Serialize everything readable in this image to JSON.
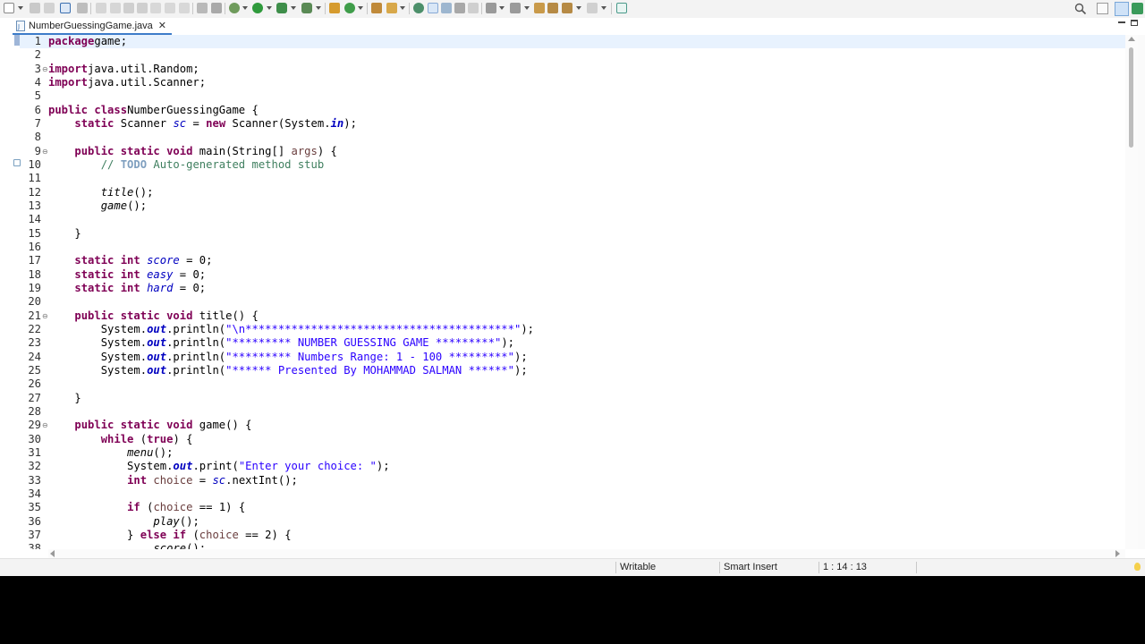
{
  "editor_tab": {
    "label": "NumberGuessingGame.java",
    "close_glyph": "✕"
  },
  "status": {
    "mode": "Writable",
    "insert_mode": "Smart Insert",
    "position": "1 : 14 : 13"
  },
  "code_lines": [
    [
      [
        "kw",
        "package"
      ],
      [
        "",
        "game;"
      ]
    ],
    [],
    [
      [
        "kw",
        "import"
      ],
      [
        "",
        "java.util.Random;"
      ]
    ],
    [
      [
        "kw",
        "import"
      ],
      [
        "",
        "java.util.Scanner;"
      ]
    ],
    [],
    [
      [
        "kw",
        "public class"
      ],
      [
        "",
        "NumberGuessingGame {"
      ]
    ],
    [
      [
        "",
        "    "
      ],
      [
        "kw",
        "static"
      ],
      [
        "",
        " Scanner "
      ],
      [
        "fld",
        "sc"
      ],
      [
        "",
        " = "
      ],
      [
        "kw",
        "new"
      ],
      [
        "",
        " Scanner(System."
      ],
      [
        "sfld",
        "in"
      ],
      [
        "",
        ");"
      ]
    ],
    [],
    [
      [
        "",
        "    "
      ],
      [
        "kw",
        "public static void"
      ],
      [
        "",
        " main(String[] "
      ],
      [
        "var",
        "args"
      ],
      [
        "",
        ") {"
      ]
    ],
    [
      [
        "",
        "        "
      ],
      [
        "cm",
        "// "
      ],
      [
        "todo",
        "TODO"
      ],
      [
        "cm",
        " Auto-generated method stub"
      ]
    ],
    [],
    [
      [
        "",
        "        "
      ],
      [
        "sm",
        "title"
      ],
      [
        "",
        "();"
      ]
    ],
    [
      [
        "",
        "        "
      ],
      [
        "sm",
        "game"
      ],
      [
        "",
        "();"
      ]
    ],
    [],
    [
      [
        "",
        "    }"
      ]
    ],
    [],
    [
      [
        "",
        "    "
      ],
      [
        "kw",
        "static int"
      ],
      [
        "",
        " "
      ],
      [
        "fld",
        "score"
      ],
      [
        "",
        " = 0;"
      ]
    ],
    [
      [
        "",
        "    "
      ],
      [
        "kw",
        "static int"
      ],
      [
        "",
        " "
      ],
      [
        "fld",
        "easy"
      ],
      [
        "",
        " = 0;"
      ]
    ],
    [
      [
        "",
        "    "
      ],
      [
        "kw",
        "static int"
      ],
      [
        "",
        " "
      ],
      [
        "fld",
        "hard"
      ],
      [
        "",
        " = 0;"
      ]
    ],
    [],
    [
      [
        "",
        "    "
      ],
      [
        "kw",
        "public static void"
      ],
      [
        "",
        " title() {"
      ]
    ],
    [
      [
        "",
        "        System."
      ],
      [
        "sfld",
        "out"
      ],
      [
        "",
        ".println("
      ],
      [
        "str",
        "\"\\n*****************************************\""
      ],
      [
        "",
        ");"
      ]
    ],
    [
      [
        "",
        "        System."
      ],
      [
        "sfld",
        "out"
      ],
      [
        "",
        ".println("
      ],
      [
        "str",
        "\"********* NUMBER GUESSING GAME *********\""
      ],
      [
        "",
        ");"
      ]
    ],
    [
      [
        "",
        "        System."
      ],
      [
        "sfld",
        "out"
      ],
      [
        "",
        ".println("
      ],
      [
        "str",
        "\"********* Numbers Range: 1 - 100 *********\""
      ],
      [
        "",
        ");"
      ]
    ],
    [
      [
        "",
        "        System."
      ],
      [
        "sfld",
        "out"
      ],
      [
        "",
        ".println("
      ],
      [
        "str",
        "\"****** Presented By MOHAMMAD SALMAN ******\""
      ],
      [
        "",
        ");"
      ]
    ],
    [],
    [
      [
        "",
        "    }"
      ]
    ],
    [],
    [
      [
        "",
        "    "
      ],
      [
        "kw",
        "public static void"
      ],
      [
        "",
        " game() {"
      ]
    ],
    [
      [
        "",
        "        "
      ],
      [
        "kw",
        "while"
      ],
      [
        "",
        " ("
      ],
      [
        "kw",
        "true"
      ],
      [
        "",
        ") {"
      ]
    ],
    [
      [
        "",
        "            "
      ],
      [
        "sm",
        "menu"
      ],
      [
        "",
        "();"
      ]
    ],
    [
      [
        "",
        "            System."
      ],
      [
        "sfld",
        "out"
      ],
      [
        "",
        ".print("
      ],
      [
        "str",
        "\"Enter your choice: \""
      ],
      [
        "",
        ");"
      ]
    ],
    [
      [
        "",
        "            "
      ],
      [
        "kw",
        "int"
      ],
      [
        "",
        " "
      ],
      [
        "var",
        "choice"
      ],
      [
        "",
        " = "
      ],
      [
        "fld",
        "sc"
      ],
      [
        "",
        ".nextInt();"
      ]
    ],
    [],
    [
      [
        "",
        "            "
      ],
      [
        "kw",
        "if"
      ],
      [
        "",
        " ("
      ],
      [
        "var",
        "choice"
      ],
      [
        "",
        " == 1) {"
      ]
    ],
    [
      [
        "",
        "                "
      ],
      [
        "sm",
        "play"
      ],
      [
        "",
        "();"
      ]
    ],
    [
      [
        "",
        "            } "
      ],
      [
        "kw",
        "else if"
      ],
      [
        "",
        " ("
      ],
      [
        "var",
        "choice"
      ],
      [
        "",
        " == 2) {"
      ]
    ],
    [
      [
        "",
        "                "
      ],
      [
        "sm",
        "score"
      ],
      [
        "",
        "();"
      ]
    ]
  ],
  "fold_lines": [
    3,
    9,
    21,
    29
  ],
  "colors": {
    "keyword": "#7f0055",
    "string": "#2a00ff",
    "comment": "#3f7f5f",
    "field": "#0000c0",
    "current_line": "#e8f2fe"
  }
}
